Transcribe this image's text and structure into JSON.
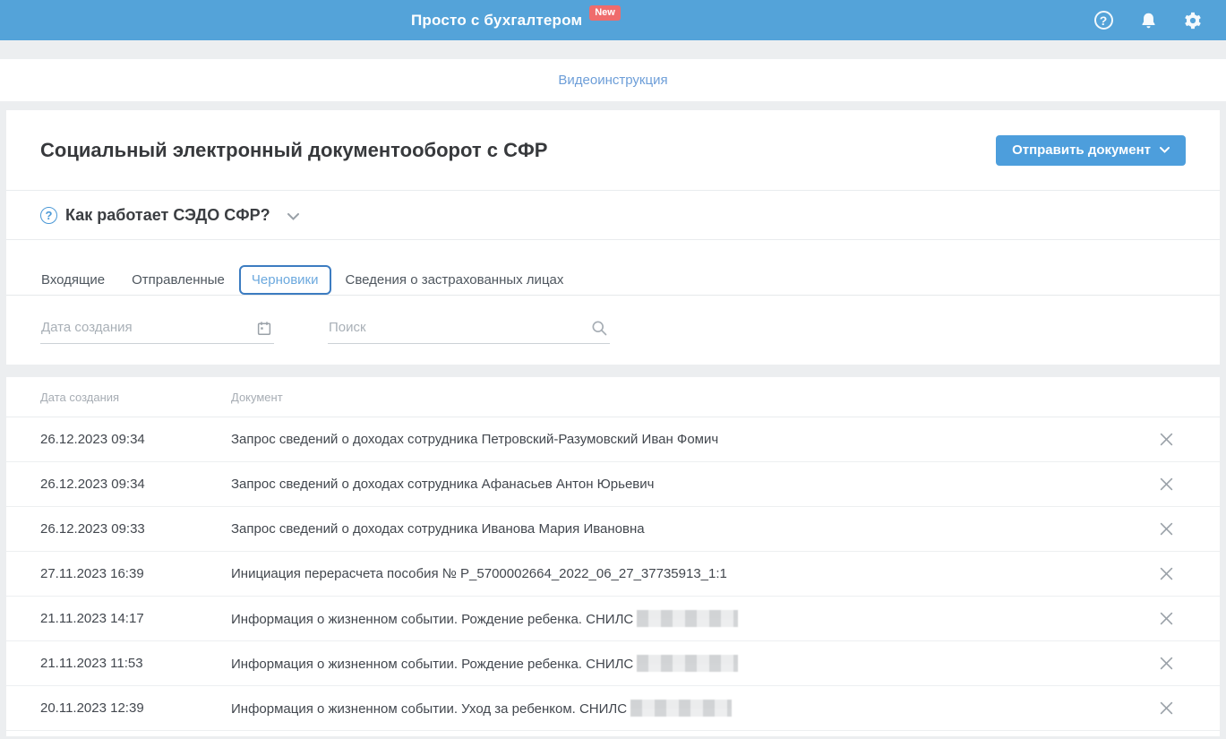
{
  "colors": {
    "header-bg": "#54a3d9",
    "badge-bg": "#ef6c6c",
    "accent-blue": "#4d9edc",
    "link-blue": "#6d9ed8",
    "active-tab-border": "#3c7cc1",
    "active-tab-text": "#6ca9de",
    "page-bg": "#eceef0"
  },
  "header": {
    "title": "Просто с бухгалтером",
    "badge": "New",
    "help_icon": "help-circle-icon",
    "bell_icon": "bell-icon",
    "gear_icon": "gear-icon",
    "help_glyph": "?"
  },
  "video_bar": {
    "link": "Видеоинструкция"
  },
  "page": {
    "title": "Социальный электронный документооборот с СФР",
    "send_button_label": "Отправить документ",
    "how_it_works_label": "Как работает СЭДО СФР?",
    "how_it_works_glyph": "?"
  },
  "tabs": [
    {
      "label": "Входящие",
      "active": false
    },
    {
      "label": "Отправленные",
      "active": false
    },
    {
      "label": "Черновики",
      "active": true
    },
    {
      "label": "Сведения о застрахованных лицах",
      "active": false
    }
  ],
  "filters": {
    "date_placeholder": "Дата создания",
    "date_icon": "calendar-icon",
    "search_placeholder": "Поиск",
    "search_icon": "search-icon"
  },
  "table": {
    "columns": [
      "Дата создания",
      "Документ"
    ],
    "row_action_icon": "close-icon",
    "rows": [
      {
        "date": "26.12.2023 09:34",
        "document": "Запрос сведений о доходах сотрудника Петровский-Разумовский Иван Фомич",
        "redacted": false
      },
      {
        "date": "26.12.2023 09:34",
        "document": "Запрос сведений о доходах сотрудника Афанасьев Антон Юрьевич",
        "redacted": false
      },
      {
        "date": "26.12.2023 09:33",
        "document": "Запрос сведений о доходах сотрудника Иванова Мария Ивановна",
        "redacted": false
      },
      {
        "date": "27.11.2023 16:39",
        "document": "Инициация перерасчета пособия № Р_5700002664_2022_06_27_37735913_1:1",
        "redacted": false
      },
      {
        "date": "21.11.2023 14:17",
        "document": "Информация о жизненном событии. Рождение ребенка. СНИЛС",
        "redacted": true
      },
      {
        "date": "21.11.2023 11:53",
        "document": "Информация о жизненном событии. Рождение ребенка. СНИЛС",
        "redacted": true
      },
      {
        "date": "20.11.2023 12:39",
        "document": "Информация о жизненном событии. Уход за ребенком. СНИЛС",
        "redacted": true
      }
    ]
  }
}
